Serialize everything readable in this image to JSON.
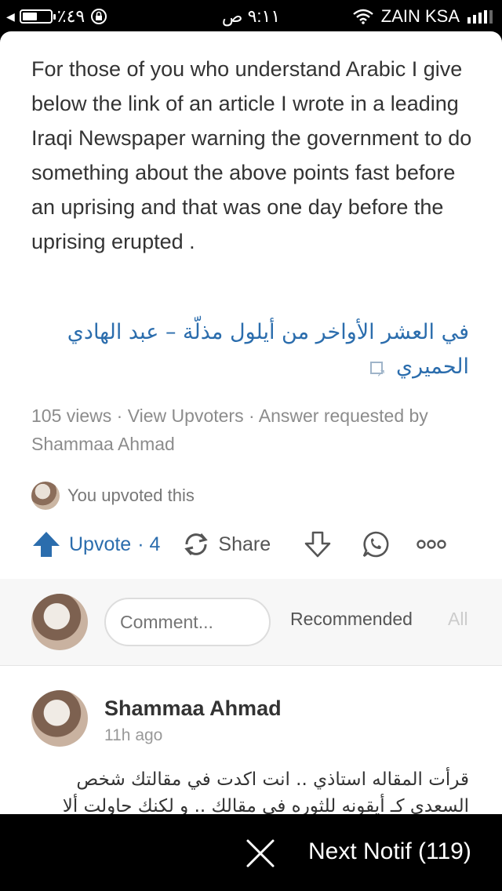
{
  "status_bar": {
    "battery_percent": "٪٤٩",
    "time": "٩:١١ ص",
    "carrier": "ZAIN KSA"
  },
  "answer": {
    "body": "For those of you who understand Arabic I give below the link of an article I wrote in a leading Iraqi Newspaper warning the government to do something about the above points fast before an uprising and that was one day before the uprising erupted .",
    "link_text": "في العشر الأواخر من أيلول مذلّة – عبد الهادي الحميري",
    "meta": "105 views · View Upvoters · Answer requested by Shammaa Ahmad",
    "upvoted_text": "You upvoted this"
  },
  "actions": {
    "upvote_label": "Upvote",
    "upvote_count": "· 4",
    "share_label": "Share",
    "icons": [
      "upvote-arrow-icon",
      "share-icon",
      "downvote-icon",
      "whatsapp-icon",
      "more-icon"
    ],
    "accent": "#2b6dad"
  },
  "comments": {
    "input_placeholder": "Comment...",
    "tab_recommended": "Recommended",
    "tab_all": "All",
    "first": {
      "author": "Shammaa Ahmad",
      "time": "11h ago",
      "text": "قرأت المقاله استاذي .. انت اكدت في مقالتك شخص السعدي كـ أيقونه للثوره في مقالك .. و لكنك حاولت ألا"
    }
  },
  "bottom_bar": {
    "next_label": "Next Notif (119)"
  }
}
